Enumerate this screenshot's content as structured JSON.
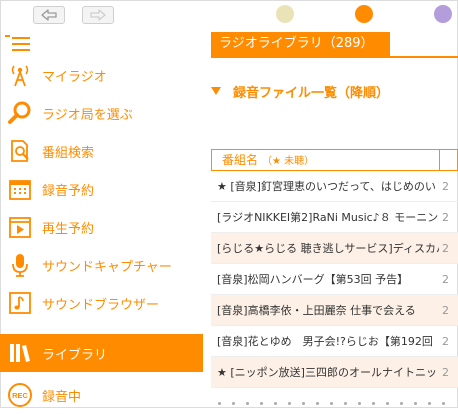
{
  "topbar": {
    "dots": [
      {
        "name": "theme-dot-cream",
        "color": "#ebe3b8"
      },
      {
        "name": "theme-dot-orange",
        "color": "#ff8c00"
      },
      {
        "name": "theme-dot-purple",
        "color": "#b39ddb"
      }
    ]
  },
  "colors": {
    "accent": "#ff8c00",
    "row_alt": "#fdf0e6"
  },
  "sidebar": {
    "items": [
      {
        "label": "マイラジオ",
        "icon": "antenna-icon"
      },
      {
        "label": "ラジオ局を選ぶ",
        "icon": "search-icon"
      },
      {
        "label": "番組検索",
        "icon": "document-search-icon"
      },
      {
        "label": "録音予約",
        "icon": "calendar-icon"
      },
      {
        "label": "再生予約",
        "icon": "play-schedule-icon"
      },
      {
        "label": "サウンドキャプチャー",
        "icon": "microphone-icon"
      },
      {
        "label": "サウンドブラウザー",
        "icon": "music-note-icon"
      },
      {
        "label": "ライブラリ",
        "icon": "library-icon",
        "active": true
      },
      {
        "label": "録音中",
        "icon": "rec-icon"
      }
    ]
  },
  "main": {
    "title": "ラジオライブラリ（289）",
    "section_title": "録音ファイル一覧（降順）",
    "table": {
      "col1_header": "番組名",
      "col1_sub": "（★ 未聴）",
      "rows": [
        {
          "name": "★ [音泉]釘宮理恵のいつだって、はじめのい",
          "c2": "2"
        },
        {
          "name": "[ラジオNIKKEI第2]RaNi Music♪８ モーニン",
          "c2": "2"
        },
        {
          "name": "[らじる★らじる 聴き逃しサービス]ディスカバー",
          "c2": "2"
        },
        {
          "name": "[音泉]松岡ハンバーグ【第53回 予告】",
          "c2": "2"
        },
        {
          "name": "[音泉]高橋李依・上田麗奈 仕事で会える",
          "c2": "2"
        },
        {
          "name": "[音泉]花とゆめ　男子会!?らじお【第192回",
          "c2": "2"
        },
        {
          "name": "★ [ニッポン放送]三四郎のオールナイトニッ",
          "c2": "2"
        }
      ]
    }
  }
}
